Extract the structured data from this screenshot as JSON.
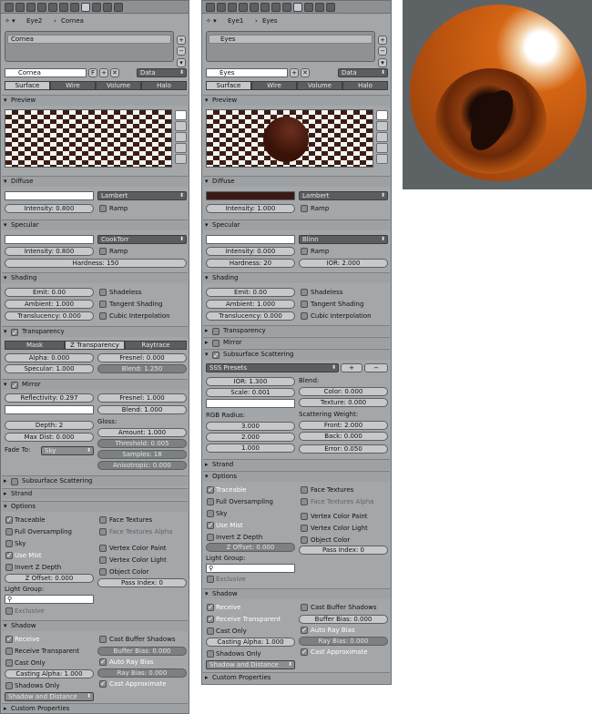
{
  "left": {
    "header": {
      "material_short": "Eye2",
      "material_name": "Cornea"
    },
    "slot_items": [
      "Cornea"
    ],
    "material_field": "Cornea",
    "users_flag": "F",
    "data_select": "Data",
    "tabs": [
      "Surface",
      "Wire",
      "Volume",
      "Halo"
    ],
    "preview": "Preview",
    "diffuse": {
      "title": "Diffuse",
      "shader": "Lambert",
      "intensity": "Intensity: 0.800",
      "ramp": "Ramp"
    },
    "specular": {
      "title": "Specular",
      "shader": "CookTorr",
      "intensity": "Intensity: 0.800",
      "ramp": "Ramp",
      "hardness": "Hardness: 150"
    },
    "shading": {
      "title": "Shading",
      "emit": "Emit: 0.00",
      "ambient": "Ambient: 1.000",
      "translucency": "Translucency: 0.000",
      "shadeless": "Shadeless",
      "tangent": "Tangent Shading",
      "cubic": "Cubic Interpolation"
    },
    "transparency": {
      "title": "Transparency",
      "modes": [
        "Mask",
        "Z Transparency",
        "Raytrace"
      ],
      "alpha": "Alpha: 0.000",
      "specular": "Specular: 1.000",
      "fresnel": "Fresnel: 0.000",
      "blend": "Blend: 1.250"
    },
    "mirror": {
      "title": "Mirror",
      "reflectivity": "Reflectivity: 0.297",
      "fresnel": "Fresnel: 1.000",
      "blend": "Blend: 1.000",
      "depth": "Depth: 2",
      "max_dist": "Max Dist: 0.000",
      "gloss": "Gloss:",
      "amount": "Amount: 1.000",
      "threshold": "Threshold: 0.005",
      "samples": "Samples: 18",
      "anisotropic": "Anisotropic: 0.000",
      "fade_to_label": "Fade To:",
      "fade_to": "Sky"
    },
    "sss": "Subsurface Scattering",
    "strand": "Strand",
    "options": {
      "title": "Options",
      "traceable": "Traceable",
      "full_os": "Full Oversampling",
      "sky": "Sky",
      "use_mist": "Use Mist",
      "invert_z": "Invert Z Depth",
      "z_offset": "Z Offset: 0.000",
      "light_group": "Light Group:",
      "exclusive": "Exclusive",
      "face_textures": "Face Textures",
      "face_textures_alpha": "Face Textures Alpha",
      "vertex_paint": "Vertex Color Paint",
      "vertex_light": "Vertex Color Light",
      "object_color": "Object Color",
      "pass_index": "Pass Index: 0"
    },
    "shadow": {
      "title": "Shadow",
      "receive": "Receive",
      "receive_transparent": "Receive Transparent",
      "cast_only": "Cast Only",
      "casting_alpha": "Casting Alpha: 1.000",
      "shadows_only": "Shadows Only",
      "shadow_distance": "Shadow and Distance",
      "cast_buffer": "Cast Buffer Shadows",
      "buffer_bias": "Buffer Bias: 0.000",
      "auto_ray": "Auto Ray Bias",
      "ray_bias": "Ray Bias: 0.000",
      "cast_approx": "Cast Approximate"
    },
    "custom": "Custom Properties"
  },
  "right": {
    "header": {
      "material_short": "Eye1",
      "material_name": "Eyes"
    },
    "slot_items": [
      "Eyes"
    ],
    "material_field": "Eyes",
    "data_select": "Data",
    "tabs": [
      "Surface",
      "Wire",
      "Volume",
      "Halo"
    ],
    "preview": "Preview",
    "diffuse": {
      "title": "Diffuse",
      "shader": "Lambert",
      "intensity": "Intensity: 1.000",
      "ramp": "Ramp"
    },
    "specular": {
      "title": "Specular",
      "shader": "Blinn",
      "intensity": "Intensity: 0.000",
      "ramp": "Ramp",
      "hardness": "Hardness: 20",
      "ior": "IOR: 2.000"
    },
    "shading": {
      "title": "Shading",
      "emit": "Emit: 0.00",
      "ambient": "Ambient: 1.000",
      "translucency": "Translucency: 0.000",
      "shadeless": "Shadeless",
      "tangent": "Tangent Shading",
      "cubic": "Cubic Interpolation"
    },
    "transparency": "Transparency",
    "mirror": "Mirror",
    "sss": {
      "title": "Subsurface Scattering",
      "presets": "SSS Presets",
      "ior": "IOR: 1.300",
      "scale": "Scale: 0.001",
      "blend": "Blend:",
      "color": "Color: 0.000",
      "texture": "Texture: 0.000",
      "rgb_radius": "RGB Radius:",
      "r": "3.000",
      "g": "2.000",
      "b": "1.000",
      "weight": "Scattering Weight:",
      "front": "Front: 2.000",
      "back": "Back: 0.000",
      "error": "Error: 0.050"
    },
    "strand": "Strand",
    "options": {
      "title": "Options",
      "traceable": "Traceable",
      "full_os": "Full Oversampling",
      "sky": "Sky",
      "use_mist": "Use Mist",
      "invert_z": "Invert Z Depth",
      "z_offset": "Z Offset: 0.000",
      "light_group": "Light Group:",
      "exclusive": "Exclusive",
      "face_textures": "Face Textures",
      "face_textures_alpha": "Face Textures Alpha",
      "vertex_paint": "Vertex Color Paint",
      "vertex_light": "Vertex Color Light",
      "object_color": "Object Color",
      "pass_index": "Pass Index: 0"
    },
    "shadow": {
      "title": "Shadow",
      "receive": "Receive",
      "receive_transparent": "Receive Transparent",
      "cast_only": "Cast Only",
      "casting_alpha": "Casting Alpha: 1.000",
      "shadows_only": "Shadows Only",
      "shadow_distance": "Shadow and Distance",
      "cast_buffer": "Cast Buffer Shadows",
      "buffer_bias": "Buffer Bias: 0.000",
      "auto_ray": "Auto Ray Bias",
      "ray_bias": "Ray Bias: 0.000",
      "cast_approx": "Cast Approximate"
    },
    "custom": "Custom Properties"
  },
  "colors": {
    "panel": "#a3a7aa",
    "eye_orange": "#d46513",
    "eye_dark": "#1f0b06",
    "checker": "#3a1e14"
  }
}
